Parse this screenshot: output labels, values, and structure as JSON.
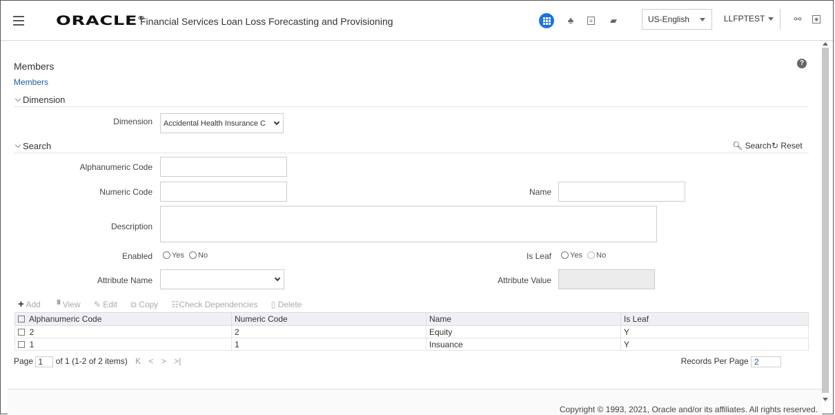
{
  "header": {
    "brand": "ORACLE",
    "product": "Financial Services Loan Loss Forecasting and Provisioning",
    "language": "US-English",
    "user": "LLFPTEST"
  },
  "page": {
    "title": "Members",
    "breadcrumb": "Members"
  },
  "dimension_section": {
    "title": "Dimension",
    "dimension_label": "Dimension",
    "dimension_value": "Accidental Health Insurance C"
  },
  "search_section": {
    "title": "Search",
    "search_label": "Search",
    "reset_label": "Reset",
    "alphanumeric_label": "Alphanumeric Code",
    "numeric_label": "Numeric Code",
    "name_label": "Name",
    "description_label": "Description",
    "enabled_label": "Enabled",
    "is_leaf_label": "Is Leaf",
    "yes_label": "Yes",
    "no_label": "No",
    "attribute_name_label": "Attribute Name",
    "attribute_value_label": "Attribute Value"
  },
  "toolbar": {
    "add": "Add",
    "view": "View",
    "edit": "Edit",
    "copy": "Copy",
    "check": "Check Dependencies",
    "delete": "Delete"
  },
  "table": {
    "columns": [
      "Alphanumeric Code",
      "Numeric Code",
      "Name",
      "Is Leaf"
    ],
    "rows": [
      [
        "2",
        "2",
        "Equity",
        "Y"
      ],
      [
        "1",
        "1",
        "Insuance",
        "Y"
      ]
    ]
  },
  "pager": {
    "page_label": "Page",
    "page_value": "1",
    "summary": "of 1 (1-2 of 2 items)",
    "records_label": "Records Per Page",
    "records_value": "2"
  },
  "footer": {
    "copyright": "Copyright © 1993, 2021, Oracle and/or its affiliates. All rights reserved."
  }
}
